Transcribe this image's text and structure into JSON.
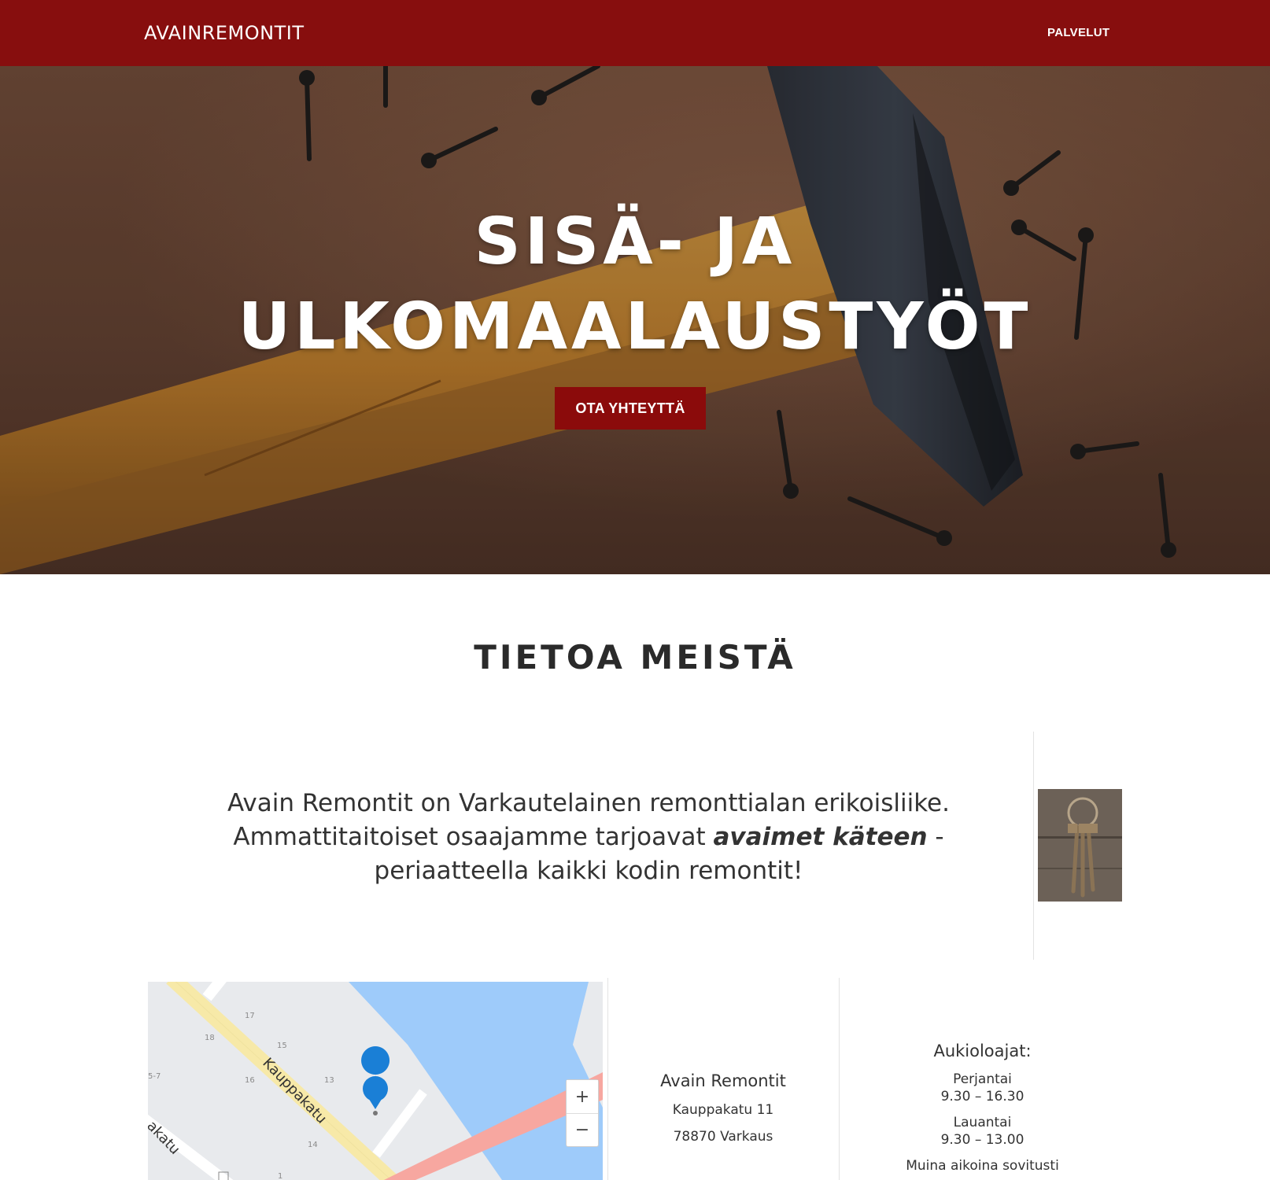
{
  "nav": {
    "brand": "AVAINREMONTIT",
    "link_services": "PALVELUT"
  },
  "hero": {
    "title_line1": "SISÄ- JA",
    "title_line2": "ULKOMAALAUSTYÖT",
    "cta_label": "OTA YHTEYTTÄ"
  },
  "about": {
    "title": "TIETOA MEISTÄ",
    "text_line1": "Avain Remontit on Varkautelainen remonttialan erikoisliike.",
    "text_line2_before": "Ammattitaitoiset osaajamme tarjoavat ",
    "text_line2_emphasis": "avaimet käteen",
    "text_line2_after": " -",
    "text_line3": "periaatteella kaikki kodin remontit!"
  },
  "map": {
    "street_main": "Kauppakatu",
    "street_partial": "akatu",
    "numbers": [
      "17",
      "18",
      "15",
      "5-7",
      "16",
      "13",
      "14",
      "1"
    ],
    "zoom_in": "+",
    "zoom_out": "−"
  },
  "contact": {
    "name": "Avain Remontit",
    "street": "Kauppakatu 11",
    "postal": "78870 Varkaus"
  },
  "hours": {
    "title": "Aukioloajat:",
    "day1": "Perjantai",
    "time1": "9.30 – 16.30",
    "day2": "Lauantai",
    "time2": "9.30 – 13.00",
    "note": "Muina aikoina sovitusti"
  },
  "colors": {
    "brand_red": "#870e0e",
    "button_red": "#8b0b0b",
    "map_water": "#9ecbfa",
    "map_road": "#f7e9a8",
    "map_highway": "#f7a7a0",
    "map_pin": "#1a7fd6"
  }
}
